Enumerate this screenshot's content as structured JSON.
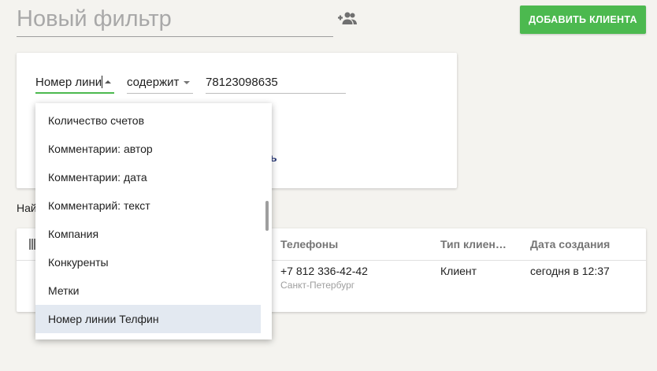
{
  "header": {
    "filter_title_placeholder": "Новый фильтр",
    "add_user_icon": "person-add-icon",
    "add_client_label": "ДОБАВИТЬ КЛИЕНТА"
  },
  "filter": {
    "field_value": "Номер лини",
    "operator_value": "содержит",
    "search_value": "78123098635",
    "partial_link": "ь"
  },
  "results": {
    "found_partial": "Най"
  },
  "table": {
    "columns_icon": "column-settings-icon",
    "headers": {
      "phones": "Телефоны",
      "type": "Тип клиен…",
      "created": "Дата создания"
    },
    "rows": [
      {
        "phone": "+7 812 336-42-42",
        "city": "Санкт-Петербург",
        "type": "Клиент",
        "created": "сегодня в 12:37"
      }
    ]
  },
  "dropdown": {
    "items": [
      {
        "label": "Количество счетов"
      },
      {
        "label": "Комментарии: автор"
      },
      {
        "label": "Комментарии: дата"
      },
      {
        "label": "Комментарий: текст"
      },
      {
        "label": "Компания"
      },
      {
        "label": "Конкуренты"
      },
      {
        "label": "Метки"
      },
      {
        "label": "Номер линии Телфин",
        "selected": true
      }
    ],
    "selected_index": 7
  },
  "colors": {
    "accent_green": "#4cb94f",
    "link_blue": "#2b3b7a",
    "selected_bg": "#e3e9f1",
    "page_bg": "#f4f3ef"
  }
}
